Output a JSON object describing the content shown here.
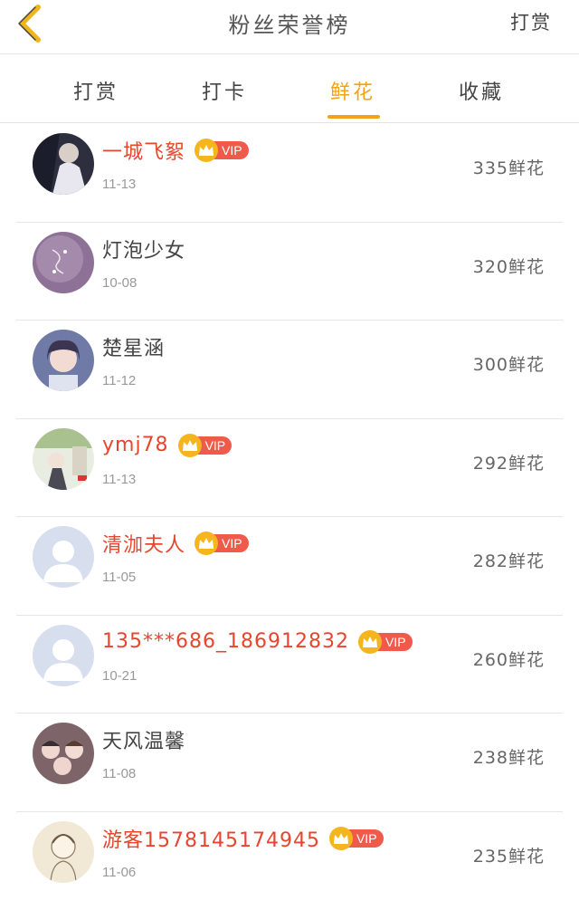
{
  "header": {
    "title": "粉丝荣誉榜",
    "right_label": "打赏"
  },
  "tabs": [
    {
      "label": "打赏",
      "active": false
    },
    {
      "label": "打卡",
      "active": false
    },
    {
      "label": "鲜花",
      "active": true
    },
    {
      "label": "收藏",
      "active": false
    }
  ],
  "colors": {
    "accent": "#f1a218",
    "vip_name": "#e8452e",
    "vip_tag": "#ef5a4a"
  },
  "vip_label": "VIP",
  "rows": [
    {
      "name": "一城飞絮",
      "vip": true,
      "date": "11-13",
      "amount": "335鲜花",
      "avatar": "photo-dark-figure"
    },
    {
      "name": "灯泡少女",
      "vip": false,
      "date": "10-08",
      "amount": "320鲜花",
      "avatar": "purple-lights"
    },
    {
      "name": "楚星涵",
      "vip": false,
      "date": "11-12",
      "amount": "300鲜花",
      "avatar": "photo-girl"
    },
    {
      "name": "ymj78",
      "vip": true,
      "date": "11-13",
      "amount": "292鲜花",
      "avatar": "illustration-garden"
    },
    {
      "name": "清泇夫人",
      "vip": true,
      "date": "11-05",
      "amount": "282鲜花",
      "avatar": "default-person"
    },
    {
      "name": "135***686_186912832",
      "vip": true,
      "date": "10-21",
      "amount": "260鲜花",
      "avatar": "default-person"
    },
    {
      "name": "天风温馨",
      "vip": false,
      "date": "11-08",
      "amount": "238鲜花",
      "avatar": "illustration-group"
    },
    {
      "name": "游客1578145174945",
      "vip": true,
      "date": "11-06",
      "amount": "235鲜花",
      "avatar": "sketch-girl"
    }
  ]
}
